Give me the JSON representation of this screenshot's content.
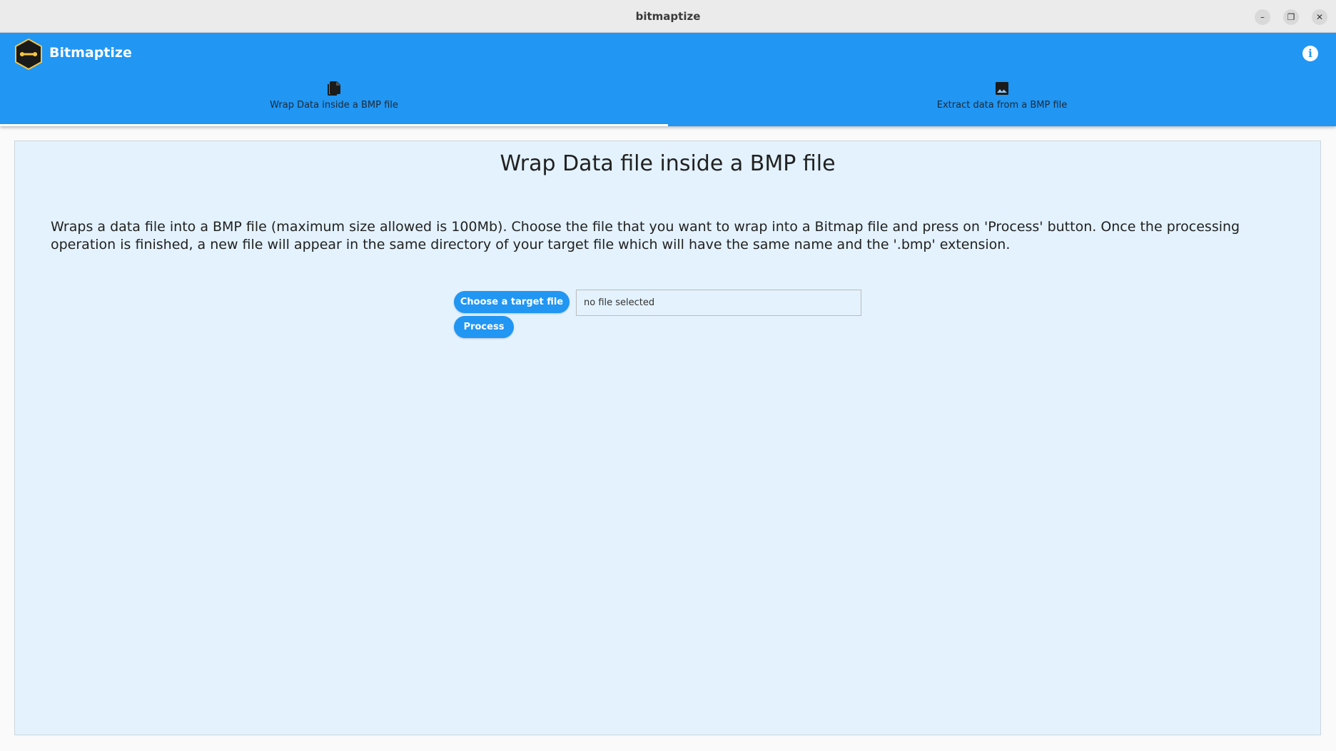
{
  "window": {
    "title": "bitmaptize",
    "minimize_glyph": "–",
    "maximize_glyph": "❐",
    "close_glyph": "✕"
  },
  "appbar": {
    "app_name": "Bitmaptize",
    "logo_icon": "hexagon-logo-icon",
    "info_icon": "info-icon",
    "info_glyph": "i",
    "accent_color": "#2196f3"
  },
  "tabs": [
    {
      "label": "Wrap Data inside a BMP file",
      "icon": "files-icon",
      "selected": true
    },
    {
      "label": "Extract data from a BMP file",
      "icon": "image-icon",
      "selected": false
    }
  ],
  "main": {
    "title": "Wrap Data file inside a BMP file",
    "description": "Wraps a data file into a BMP file (maximum size allowed is 100Mb). Choose the file that you want to wrap into a Bitmap file and press on 'Process' button. Once the processing operation is finished, a new file will appear in the same directory of your target file which will have the same name and the '.bmp' extension.",
    "choose_button_label": "Choose a target file",
    "file_field_value": "no file selected",
    "process_button_label": "Process",
    "background_color": "#e3f2fd"
  }
}
